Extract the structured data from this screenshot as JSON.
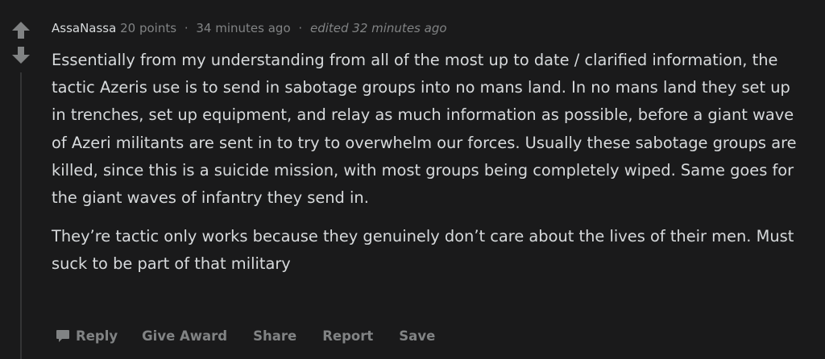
{
  "comment": {
    "author": "AssaNassa",
    "points": "20 points",
    "separator": "·",
    "time": "34 minutes ago",
    "edited": "edited 32 minutes ago",
    "paragraphs": [
      "Essentially from my understanding from all of the most up to date / clarified information, the tactic Azeris use is to send in sabotage groups into no mans land. In no mans land they set up in trenches, set up equipment, and relay as much information as possible, before a giant wave of Azeri militants are sent in to try to overwhelm our forces. Usually these sabotage groups are killed, since this is a suicide mission, with most groups being completely wiped. Same goes for the giant waves of infantry they send in.",
      "They’re tactic only works because they genuinely don’t care about the lives of their men. Must suck to be part of that military"
    ]
  },
  "actions": {
    "reply": "Reply",
    "give_award": "Give Award",
    "share": "Share",
    "report": "Report",
    "save": "Save"
  },
  "icons": {
    "upvote": "arrow-up-icon",
    "downvote": "arrow-down-icon",
    "reply": "chat-bubble-icon"
  },
  "colors": {
    "background": "#1a1a1b",
    "text": "#d7dadc",
    "muted": "#818384",
    "thread_line": "#343536"
  }
}
